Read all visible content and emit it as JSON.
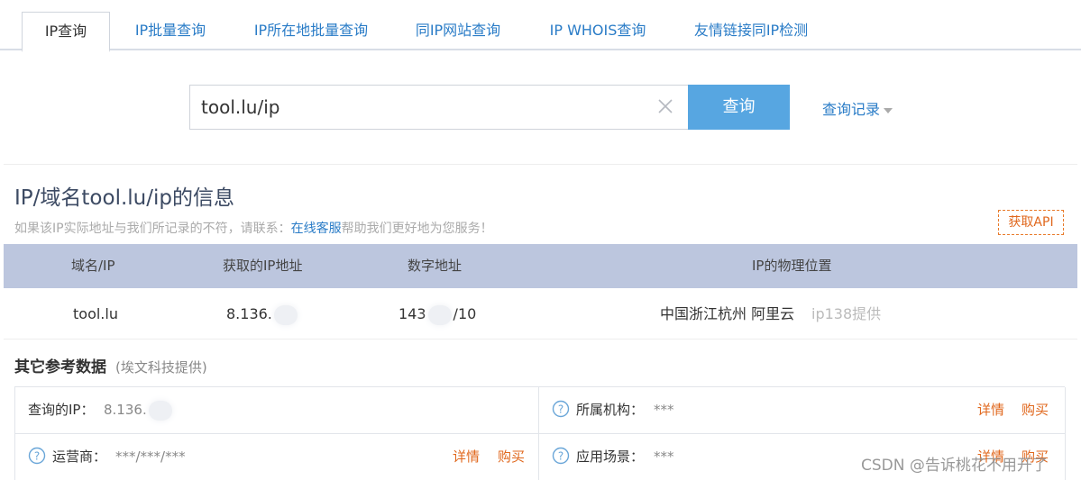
{
  "tabs": [
    {
      "label": "IP查询",
      "active": true
    },
    {
      "label": "IP批量查询",
      "active": false
    },
    {
      "label": "IP所在地批量查询",
      "active": false
    },
    {
      "label": "同IP网站查询",
      "active": false
    },
    {
      "label": "IP WHOIS查询",
      "active": false
    },
    {
      "label": "友情链接同IP检测",
      "active": false
    }
  ],
  "search": {
    "value": "tool.lu/ip",
    "button_label": "查询",
    "history_label": "查询记录"
  },
  "info": {
    "title": "IP/域名tool.lu/ip的信息",
    "subtitle_before": "如果该IP实际地址与我们所记录的不符，请联系：",
    "subtitle_link": "在线客服",
    "subtitle_after": "帮助我们更好地为您服务！",
    "api_button": "获取API"
  },
  "table": {
    "headers": [
      "域名/IP",
      "获取的IP地址",
      "数字地址",
      "IP的物理位置"
    ],
    "row": {
      "domain": "tool.lu",
      "ip_prefix": "8.136.",
      "numeric_prefix": "143",
      "numeric_suffix": "/10",
      "location": "中国浙江杭州 阿里云",
      "provider": "ip138提供"
    }
  },
  "reference": {
    "title": "其它参考数据",
    "source": "(埃文科技提供)",
    "query_ip_label": "查询的IP：",
    "query_ip_value": "8.136.",
    "org_label": "所属机构：",
    "org_value": "***",
    "isp_label": "运营商：",
    "isp_value": "***/***/***",
    "scene_label": "应用场景：",
    "scene_value": "***",
    "detail_label": "详情",
    "buy_label": "购买"
  },
  "watermark": "CSDN @告诉桃花不用开了",
  "colors": {
    "link": "#2a7cc7",
    "button": "#57a6e1",
    "accent": "#e0671c",
    "table_header": "#bcc6de"
  },
  "icons": {
    "clear": "close-icon",
    "history_caret": "caret-down-icon",
    "help": "question-circle-icon"
  }
}
